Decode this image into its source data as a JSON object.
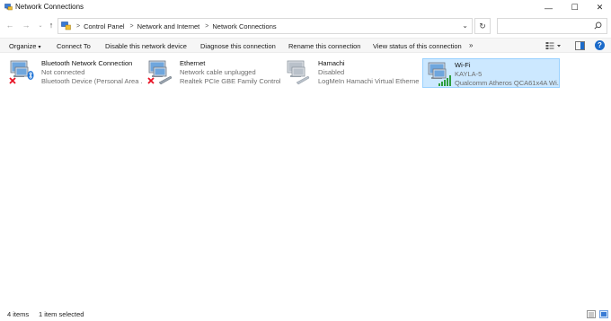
{
  "window": {
    "title": "Network Connections",
    "controls": {
      "minimize": "—",
      "maximize": "☐",
      "close": "✕"
    }
  },
  "nav": {
    "back": "←",
    "forward": "→",
    "recent": "⌄",
    "up": "↑",
    "breadcrumbs": [
      "Control Panel",
      "Network and Internet",
      "Network Connections"
    ],
    "breadcrumb_separator": ">",
    "dropdown": "⌄",
    "refresh": "↻",
    "search_placeholder": ""
  },
  "commands": {
    "organize": "Organize",
    "organize_caret": "▾",
    "connect_to": "Connect To",
    "disable": "Disable this network device",
    "diagnose": "Diagnose this connection",
    "rename": "Rename this connection",
    "view_status": "View status of this connection",
    "more": "»",
    "help": "?"
  },
  "connections": [
    {
      "name": "Bluetooth Network Connection",
      "status": "Not connected",
      "device": "Bluetooth Device (Personal Area ...",
      "icon": "bluetooth-network-icon",
      "badge": "red-x",
      "selected": false
    },
    {
      "name": "Ethernet",
      "status": "Network cable unplugged",
      "device": "Realtek PCIe GBE Family Controller",
      "icon": "ethernet-network-icon",
      "badge": "red-x",
      "selected": false
    },
    {
      "name": "Hamachi",
      "status": "Disabled",
      "device": "LogMeIn Hamachi Virtual Etherne...",
      "icon": "hamachi-network-icon",
      "badge": "none",
      "selected": false
    },
    {
      "name": "Wi-Fi",
      "status": "KAYLA-5",
      "device": "Qualcomm Atheros QCA61x4A Wi...",
      "icon": "wifi-network-icon",
      "badge": "signal-bars",
      "selected": true
    }
  ],
  "status_bar": {
    "item_count": "4 items",
    "selection": "1 item selected"
  },
  "colors": {
    "selection_bg": "#cce8ff",
    "selection_border": "#99d1ff",
    "error_red": "#e81123",
    "signal_green": "#2e9e3e",
    "help_blue": "#1b6ac9"
  }
}
